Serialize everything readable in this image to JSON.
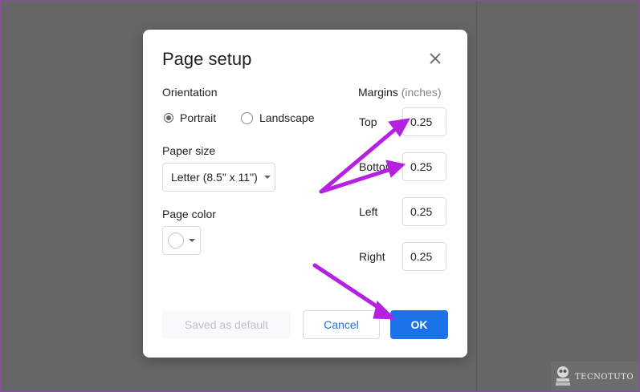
{
  "dialog": {
    "title": "Page setup",
    "close_icon": "close-icon",
    "orientation": {
      "label": "Orientation",
      "options": [
        {
          "label": "Portrait",
          "selected": true
        },
        {
          "label": "Landscape",
          "selected": false
        }
      ]
    },
    "paper_size": {
      "label": "Paper size",
      "value": "Letter (8.5\" x 11\")"
    },
    "page_color": {
      "label": "Page color",
      "value": "#ffffff"
    },
    "margins": {
      "label": "Margins",
      "unit": "(inches)",
      "fields": [
        {
          "label": "Top",
          "value": "0.25"
        },
        {
          "label": "Bottom",
          "value": "0.25"
        },
        {
          "label": "Left",
          "value": "0.25"
        },
        {
          "label": "Right",
          "value": "0.25"
        }
      ]
    },
    "buttons": {
      "save_default": "Saved as default",
      "cancel": "Cancel",
      "ok": "OK"
    }
  },
  "watermark": {
    "text": "TECNOTUTO"
  },
  "colors": {
    "accent": "#1a73e8",
    "annotation_arrow": "#b620e0",
    "backdrop": "#666666"
  }
}
